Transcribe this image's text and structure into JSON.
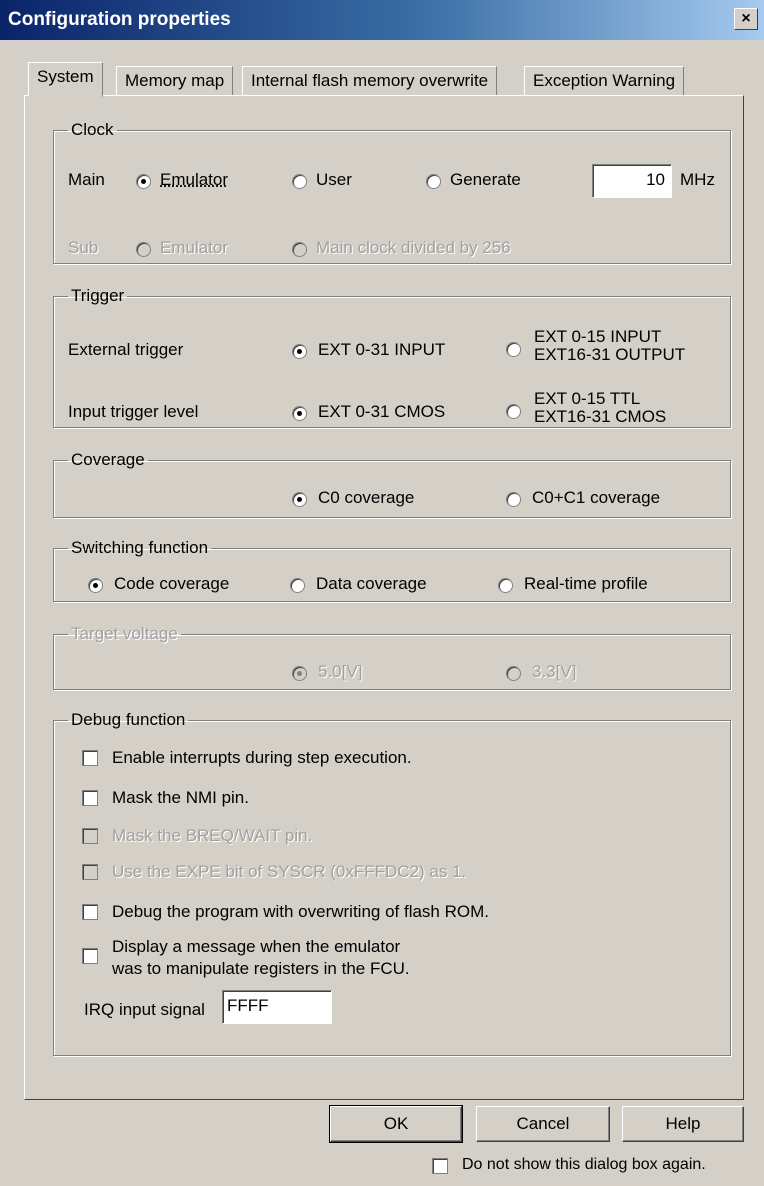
{
  "window": {
    "title": "Configuration properties",
    "close_glyph": "×"
  },
  "tabs": [
    {
      "label": "System",
      "active": true
    },
    {
      "label": "Memory map",
      "active": false
    },
    {
      "label": "Internal flash memory overwrite",
      "active": false
    },
    {
      "label": "Exception Warning",
      "active": false
    }
  ],
  "clock": {
    "legend": "Clock",
    "main_label": "Main",
    "main_options": [
      "Emulator",
      "User",
      "Generate"
    ],
    "main_selected": "Emulator",
    "frequency_value": "10",
    "frequency_unit": "MHz",
    "sub_label": "Sub",
    "sub_options": [
      "Emulator",
      "Main clock divided by 256"
    ]
  },
  "trigger": {
    "legend": "Trigger",
    "external_label": "External trigger",
    "external_opt1": "EXT 0-31  INPUT",
    "external_opt2_line1": "EXT 0-15  INPUT",
    "external_opt2_line2": "EXT16-31  OUTPUT",
    "input_level_label": "Input trigger level",
    "input_opt1": "EXT 0-31  CMOS",
    "input_opt2_line1": "EXT 0-15  TTL",
    "input_opt2_line2": "EXT16-31  CMOS"
  },
  "coverage": {
    "legend": "Coverage",
    "options": [
      "C0 coverage",
      "C0+C1 coverage"
    ],
    "selected": "C0 coverage"
  },
  "switching": {
    "legend": "Switching function",
    "options": [
      "Code coverage",
      "Data coverage",
      "Real-time profile"
    ],
    "selected": "Code coverage"
  },
  "target_voltage": {
    "legend": "Target voltage",
    "options": [
      "5.0[V]",
      "3.3[V]"
    ],
    "selected": "5.0[V]"
  },
  "debug": {
    "legend": "Debug function",
    "items": [
      {
        "label": "Enable interrupts during step execution.",
        "enabled": true
      },
      {
        "label": "Mask the NMI pin.",
        "enabled": true
      },
      {
        "label": "Mask the BREQ/WAIT pin.",
        "enabled": false
      },
      {
        "label": "Use the EXPE bit of SYSCR (0xFFFDC2) as 1.",
        "enabled": false
      },
      {
        "label": "Debug the program with overwriting of flash ROM.",
        "enabled": true
      }
    ],
    "message_line1": "Display a message when the emulator",
    "message_line2": "was to manipulate registers in the FCU.",
    "irq_label": "IRQ input signal",
    "irq_value": "FFFF"
  },
  "buttons": {
    "ok": "OK",
    "cancel": "Cancel",
    "help": "Help"
  },
  "footer": {
    "dont_show_label": "Do not show this dialog box again."
  }
}
